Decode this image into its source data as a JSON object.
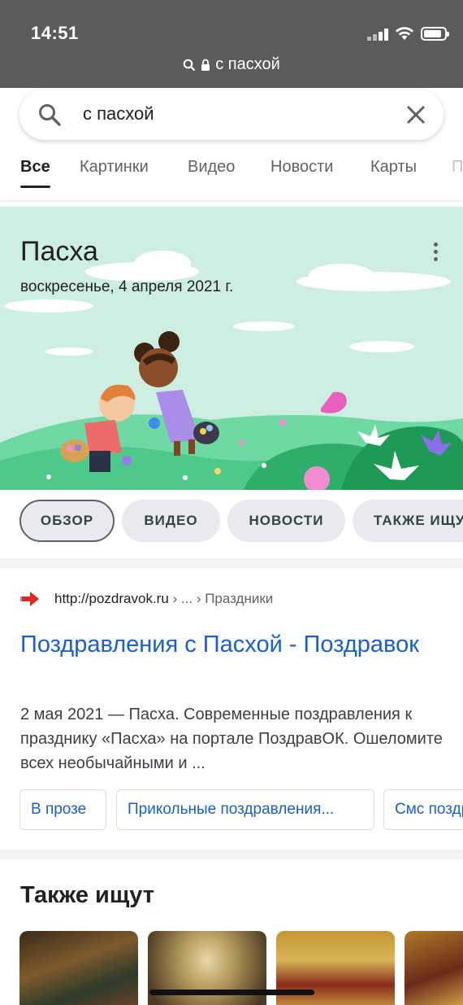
{
  "status": {
    "time": "14:51"
  },
  "browser": {
    "url": "с пасхой"
  },
  "search": {
    "query": "с пасхой"
  },
  "tabs": [
    {
      "label": "Все",
      "active": true
    },
    {
      "label": "Картинки"
    },
    {
      "label": "Видео"
    },
    {
      "label": "Новости"
    },
    {
      "label": "Карты"
    },
    {
      "label": "П"
    }
  ],
  "hero": {
    "title": "Пасха",
    "date": "воскресенье, 4 апреля 2021 г."
  },
  "chips": [
    {
      "label": "ОБЗОР"
    },
    {
      "label": "ВИДЕО"
    },
    {
      "label": "НОВОСТИ"
    },
    {
      "label": "ТАКЖЕ ИЩУ"
    }
  ],
  "result": {
    "site": "http://pozdravok.ru",
    "breadcrumb": " › ... › Праздники",
    "title": "Поздравления с Пасхой - Поздравок",
    "snippet": "2 мая 2021 — Пасха. Современные поздравления к празднику «Пасха» на портале ПоздравОК. Ошеломите всех необычайными и ...",
    "sitelinks": [
      "В прозе",
      "Прикольные поздравления...",
      "Смс поздр"
    ]
  },
  "also_search": {
    "title": "Также ищут"
  },
  "colors": {
    "link": "#1a5fcb",
    "hero_bg": "#cdeee0",
    "topbar": "#5b5b5b"
  }
}
